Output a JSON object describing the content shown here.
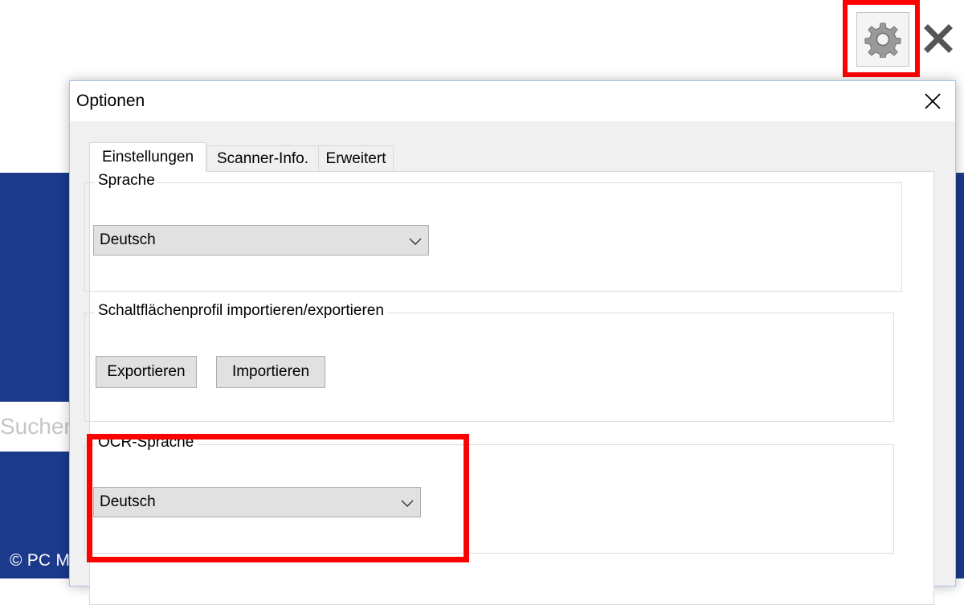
{
  "background": {
    "search_placeholder": "Suchen",
    "watermark": "© PC Magazin",
    "colors": {
      "app_blue": "#1b3a8c",
      "highlight": "#ff0000"
    },
    "icons": {
      "settings": "gear-icon",
      "close": "close-x-icon"
    }
  },
  "dialog": {
    "title": "Optionen",
    "close_icon": "close-icon",
    "tabs": [
      {
        "label": "Einstellungen",
        "active": true
      },
      {
        "label": "Scanner-Info.",
        "active": false
      },
      {
        "label": "Erweitert",
        "active": false
      }
    ],
    "groups": {
      "sprache": {
        "legend": "Sprache",
        "selected": "Deutsch"
      },
      "profil": {
        "legend": "Schaltflächenprofil importieren/exportieren",
        "export_label": "Exportieren",
        "import_label": "Importieren"
      },
      "ocr": {
        "legend": "OCR-Sprache",
        "selected": "Deutsch"
      }
    }
  }
}
